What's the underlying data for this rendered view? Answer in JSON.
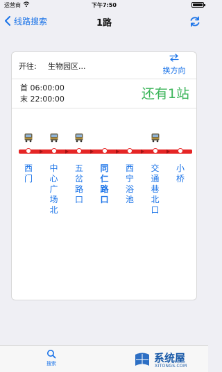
{
  "status_bar": {
    "carrier": "运营商",
    "time": "下午7:50"
  },
  "nav": {
    "back_label": "线路搜索",
    "title": "1路"
  },
  "direction": {
    "label": "开往:",
    "destination": "生物园区...",
    "switch_label": "换方向"
  },
  "schedule": {
    "first_bus": "首  06:00:00",
    "last_bus": "末  22:00:00"
  },
  "countdown": "还有1站",
  "colors": {
    "accent": "#1a73e8",
    "route_line": "#e52525",
    "countdown": "#3cb55a"
  },
  "stops": [
    {
      "name": "西门",
      "has_bus": true,
      "current": false
    },
    {
      "name": "中心广场北",
      "has_bus": true,
      "current": false
    },
    {
      "name": "五岔路口",
      "has_bus": true,
      "current": false
    },
    {
      "name": "同仁路口",
      "has_bus": false,
      "current": true
    },
    {
      "name": "西宁浴池",
      "has_bus": false,
      "current": false
    },
    {
      "name": "交通巷北口",
      "has_bus": true,
      "current": false
    },
    {
      "name": "小桥",
      "has_bus": false,
      "current": false
    }
  ],
  "tabbar": {
    "search_label": "搜索"
  },
  "watermark": {
    "name": "系统屋",
    "domain": "XITONGS.COM"
  }
}
